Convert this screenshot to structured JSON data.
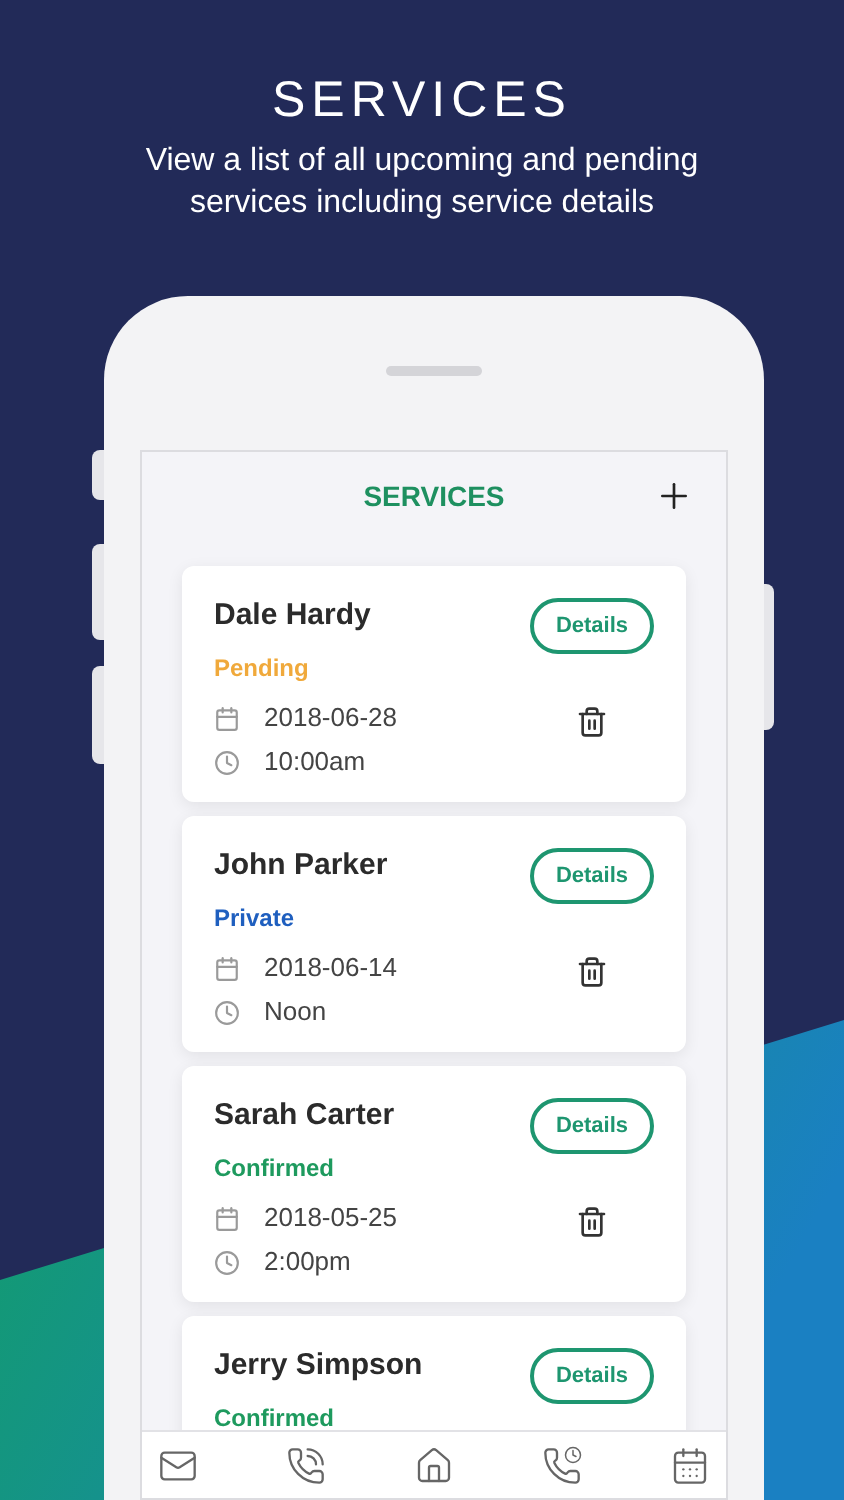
{
  "promo": {
    "title": "SERVICES",
    "subtitle": "View a list of all upcoming and pending services including service details"
  },
  "screen": {
    "title": "SERVICES"
  },
  "services": [
    {
      "name": "Dale Hardy",
      "status": "Pending",
      "color": "#f0a93b",
      "details_label": "Details",
      "date": "2018-06-28",
      "time": "10:00am"
    },
    {
      "name": "John Parker",
      "status": "Private",
      "color": "#1f5fbf",
      "details_label": "Details",
      "date": "2018-06-14",
      "time": "Noon"
    },
    {
      "name": "Sarah Carter",
      "status": "Confirmed",
      "color": "#1e9a5e",
      "details_label": "Details",
      "date": "2018-05-25",
      "time": "2:00pm"
    },
    {
      "name": "Jerry Simpson",
      "status": "Confirmed",
      "color": "#1e9a5e",
      "details_label": "Details"
    }
  ]
}
